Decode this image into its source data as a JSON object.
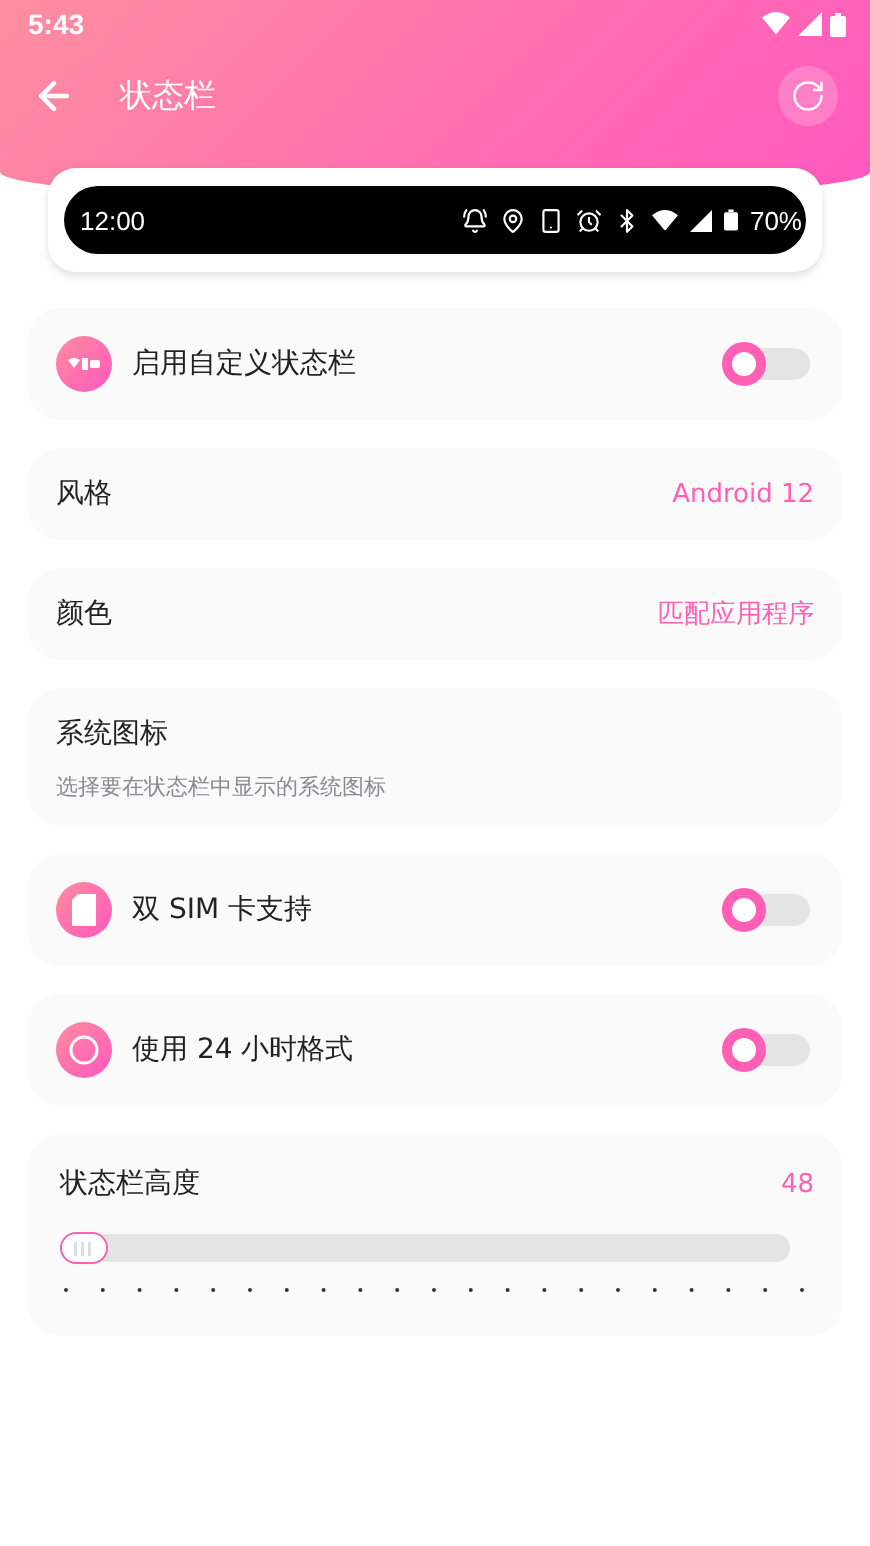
{
  "status_bar": {
    "time": "5:43"
  },
  "toolbar": {
    "title": "状态栏"
  },
  "preview": {
    "time": "12:00",
    "battery": "70%"
  },
  "settings": [
    {
      "kind": "toggle",
      "label": "启用自定义状态栏",
      "on": false
    },
    {
      "kind": "value",
      "label": "风格",
      "value": "Android 12"
    },
    {
      "kind": "value",
      "label": "颜色",
      "value": "匹配应用程序"
    },
    {
      "kind": "info",
      "label": "系统图标",
      "description": "选择要在状态栏中显示的系统图标"
    },
    {
      "kind": "toggle",
      "label": "双 SIM 卡支持",
      "on": false
    },
    {
      "kind": "toggle",
      "label": "使用 24 小时格式",
      "on": false
    },
    {
      "kind": "slider",
      "label": "状态栏高度",
      "value": "48",
      "level": 0
    }
  ]
}
